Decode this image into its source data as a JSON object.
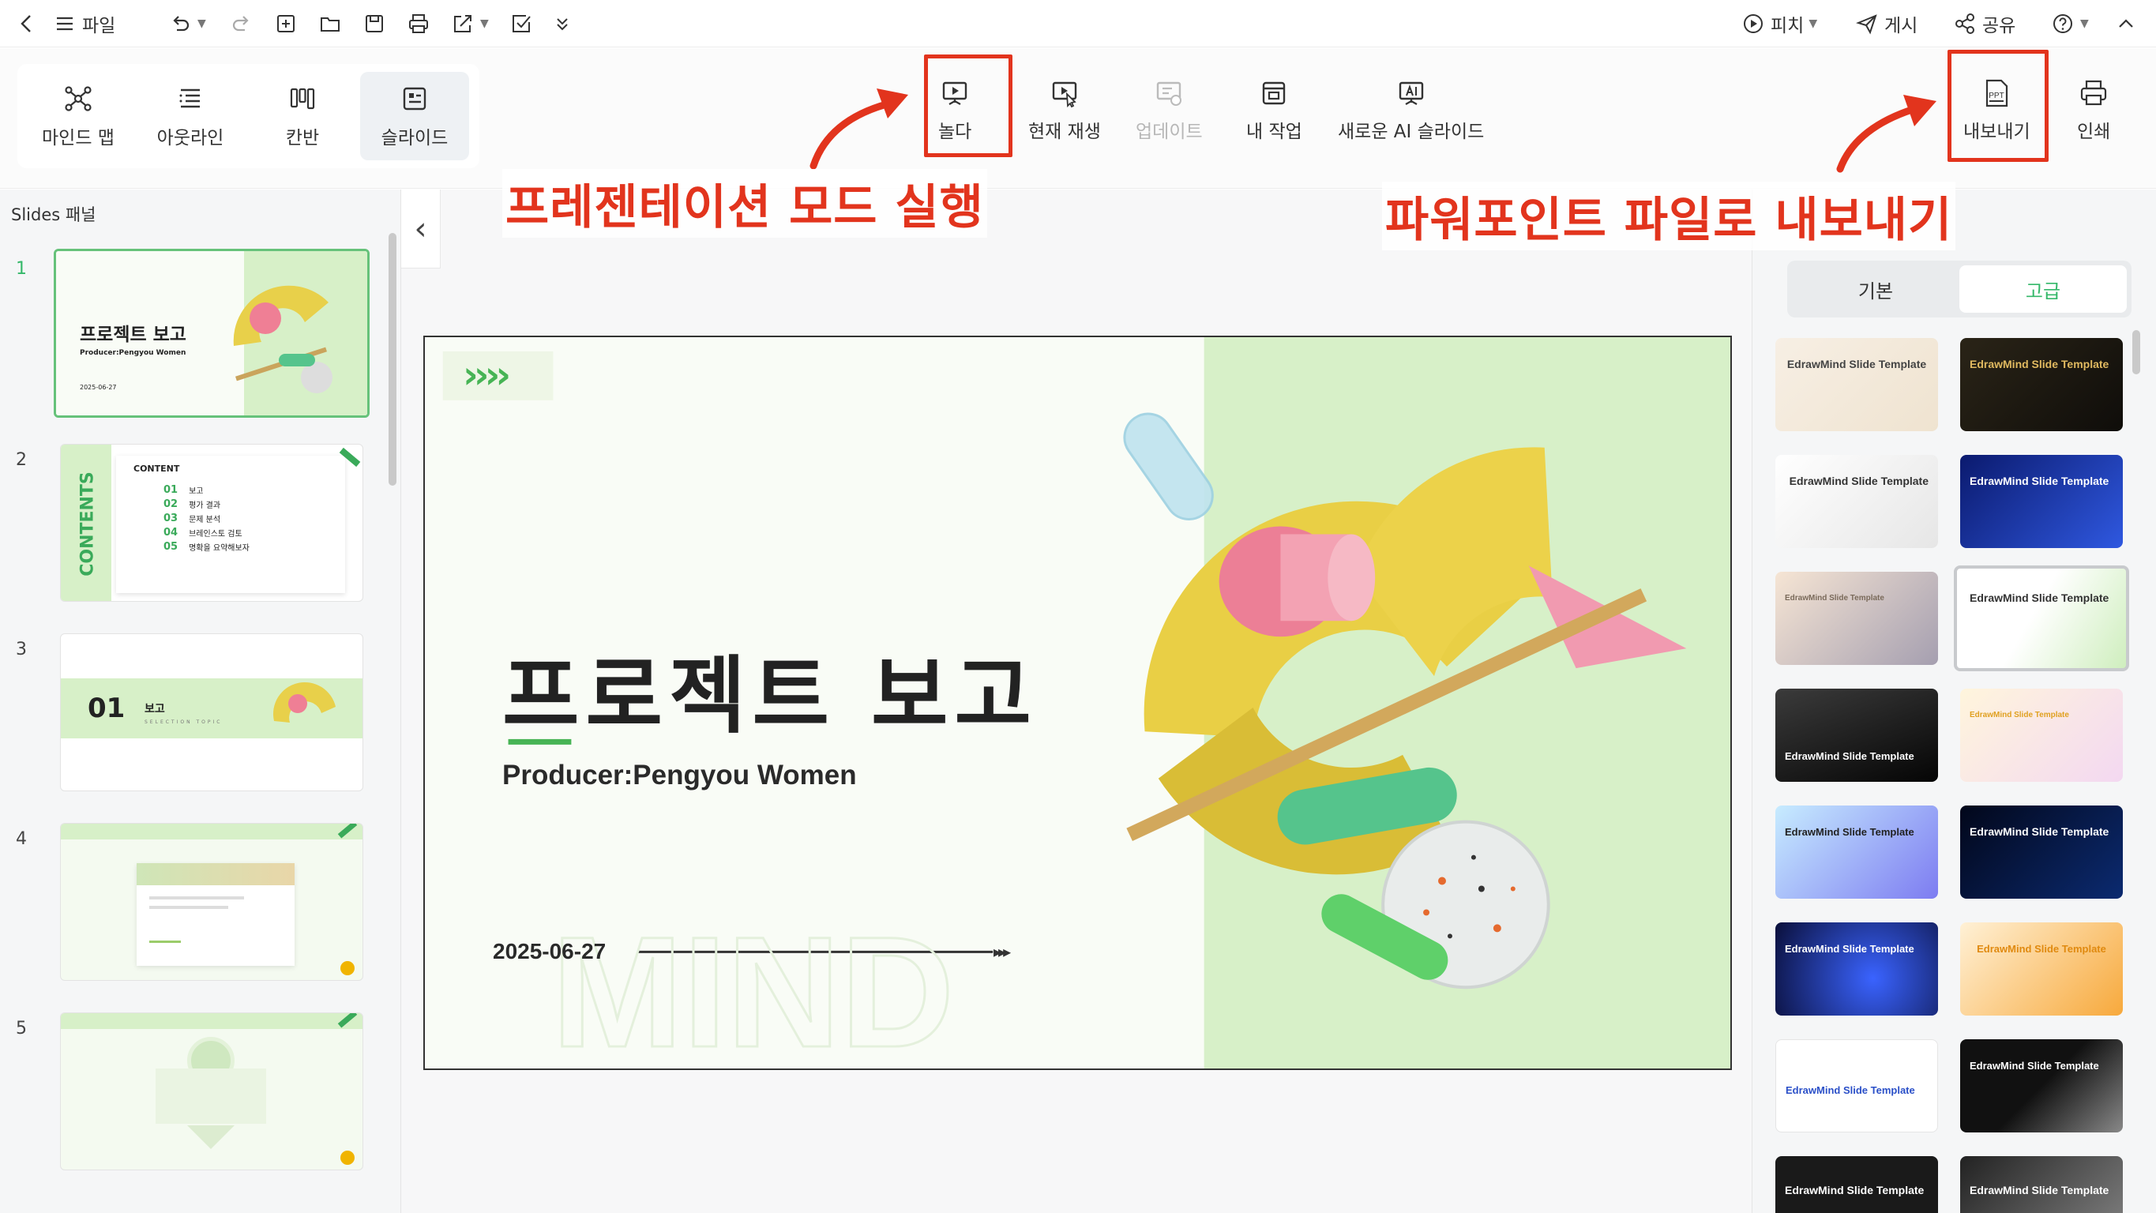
{
  "topbar": {
    "file_label": "파일",
    "pitch_label": "피치",
    "publish_label": "게시",
    "share_label": "공유"
  },
  "views": {
    "mindmap": "마인드 맵",
    "outline": "아웃라인",
    "kanban": "칸반",
    "slides": "슬라이드"
  },
  "tools": {
    "play": "놀다",
    "play_current": "현재 재생",
    "update": "업데이트",
    "my_work": "내 작업",
    "ai_slides": "새로운 AI 슬라이드",
    "export": "내보내기",
    "print": "인쇄"
  },
  "annotations": {
    "presentation": "프레젠테이션 모드 실행",
    "export_ppt": "파워포인트 파일로 내보내기"
  },
  "left_panel": {
    "title": "Slides 패널",
    "numbers": [
      "1",
      "2",
      "3",
      "4",
      "5"
    ]
  },
  "thumbs": {
    "t1_title": "프로젝트 보고",
    "t1_sub": "Producer:Pengyou Women",
    "t1_date": "2025-06-27",
    "t2_vertical": "CONTENTS",
    "t2_header": "CONTENT",
    "t2_items": [
      {
        "num": "01",
        "text": "보고"
      },
      {
        "num": "02",
        "text": "평가 결과"
      },
      {
        "num": "03",
        "text": "문제 분석"
      },
      {
        "num": "04",
        "text": "브레인스토 검토"
      },
      {
        "num": "05",
        "text": "명확을 요약해보자"
      }
    ],
    "t3_num": "01",
    "t3_title": "보고",
    "t3_sub": "SELECTION TOPIC"
  },
  "slide": {
    "chevrons": "››››",
    "title": "프로젝트 보고",
    "producer": "Producer:Pengyou Women",
    "date": "2025-06-27",
    "watermark": "MIND"
  },
  "right_panel": {
    "tab_basic": "기본",
    "tab_advanced": "고급",
    "tpl_title": "EdrawMind Slide Template"
  },
  "colors": {
    "accent_green": "#35b86a",
    "annotation_red": "#e2341d",
    "slide_green": "#d7f0c8"
  }
}
